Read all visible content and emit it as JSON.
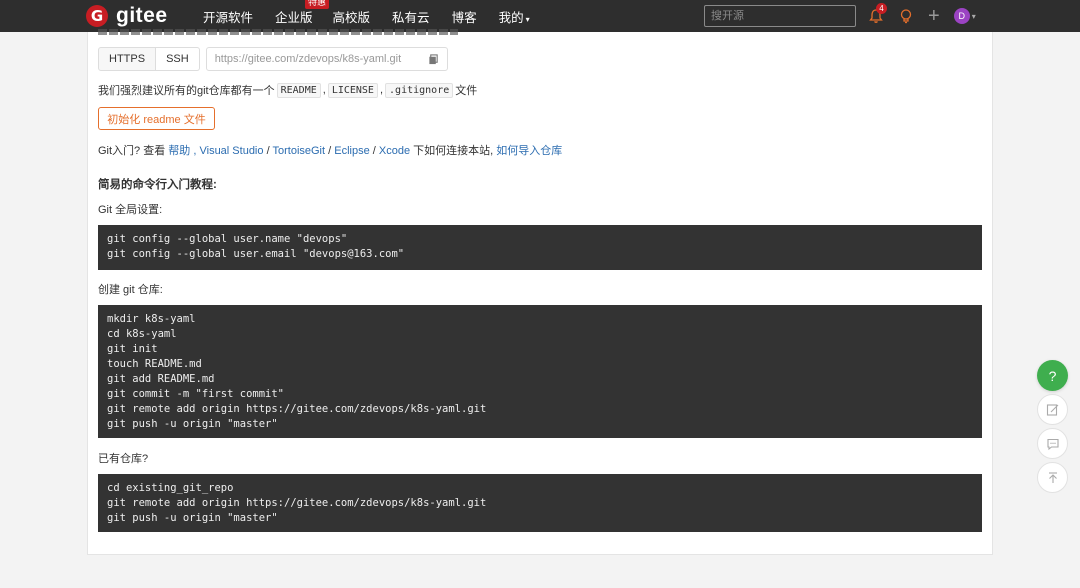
{
  "nav": {
    "brand": "gitee",
    "logo_letter": "G",
    "items": [
      "开源软件",
      "企业版",
      "高校版",
      "私有云",
      "博客",
      "我的"
    ],
    "enterprise_badge": "特惠",
    "mine_caret": "▾",
    "search_placeholder": "搜开源",
    "notification_count": "4",
    "plus": "+",
    "avatar_letter": "D",
    "avatar_caret": "▾",
    "accent": "#c71d23"
  },
  "clone": {
    "https_label": "HTTPS",
    "ssh_label": "SSH",
    "url": "https://gitee.com/zdevops/k8s-yaml.git"
  },
  "recommend": {
    "prefix": "我们强烈建议所有的git仓库都有一个",
    "file1": "README",
    "sep1": ",",
    "file2": "LICENSE",
    "sep2": ",",
    "file3": ".gitignore",
    "suffix": "文件"
  },
  "init_button": "初始化 readme 文件",
  "git_intro": {
    "prefix": "Git入门? 查看",
    "help": "帮助",
    "sep0": ",",
    "visual_studio": "Visual Studio",
    "slash1": "/",
    "tortoisegit": "TortoiseGit",
    "slash2": "/",
    "eclipse": "Eclipse",
    "slash3": "/",
    "xcode": "Xcode",
    "middle": "下如何连接本站,",
    "import_link": "如何导入仓库"
  },
  "tutorial": {
    "title": "简易的命令行入门教程:",
    "global_label": "Git 全局设置:",
    "global_code": "git config --global user.name \"devops\"\ngit config --global user.email \"devops@163.com\"",
    "create_label": "创建 git 仓库:",
    "create_code": "mkdir k8s-yaml\ncd k8s-yaml\ngit init\ntouch README.md\ngit add README.md\ngit commit -m \"first commit\"\ngit remote add origin https://gitee.com/zdevops/k8s-yaml.git\ngit push -u origin \"master\"",
    "existing_label": "已有仓库?",
    "existing_code": "cd existing_git_repo\ngit remote add origin https://gitee.com/zdevops/k8s-yaml.git\ngit push -u origin \"master\""
  },
  "float": {
    "help": "?"
  }
}
